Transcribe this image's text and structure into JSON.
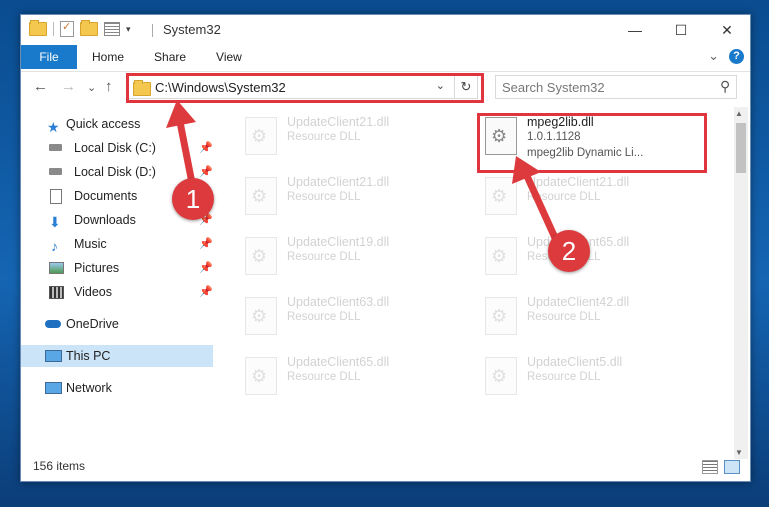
{
  "window": {
    "title": "System32",
    "minimize": "—",
    "maximize": "☐",
    "close": "✕"
  },
  "ribbon": {
    "tabs": [
      "File",
      "Home",
      "Share",
      "View"
    ],
    "expand": "⌄",
    "help": "?"
  },
  "nav": {
    "back": "←",
    "forward": "→",
    "recent": "⌄",
    "up": "↑",
    "address": "C:\\Windows\\System32",
    "address_drop": "⌄",
    "refresh": "↻",
    "search_placeholder": "Search System32",
    "search_icon": "⚲"
  },
  "sidebar": {
    "items": [
      {
        "label": "Quick access",
        "icon": "star-icon"
      },
      {
        "label": "Local Disk (C:)",
        "icon": "drive-icon",
        "pinned": true
      },
      {
        "label": "Local Disk (D:)",
        "icon": "drive-icon",
        "pinned": true
      },
      {
        "label": "Documents",
        "icon": "documents-icon",
        "pinned": true
      },
      {
        "label": "Downloads",
        "icon": "downloads-icon",
        "pinned": true
      },
      {
        "label": "Music",
        "icon": "music-icon",
        "pinned": true
      },
      {
        "label": "Pictures",
        "icon": "pictures-icon",
        "pinned": true
      },
      {
        "label": "Videos",
        "icon": "videos-icon",
        "pinned": true
      },
      {
        "label": "OneDrive",
        "icon": "cloud-icon"
      },
      {
        "label": "This PC",
        "icon": "computer-icon",
        "selected": true
      },
      {
        "label": "Network",
        "icon": "network-icon"
      }
    ],
    "pin": "📌"
  },
  "files": [
    {
      "name": "UpdateClient21.dll",
      "type": "Resource DLL"
    },
    {
      "name": "mpeg2lib.dll",
      "version": "1.0.1.1128",
      "desc": "mpeg2lib Dynamic Li..."
    },
    {
      "name": "UpdateClient21.dll",
      "type": "Resource DLL"
    },
    {
      "name": "UpdateClient21.dll",
      "type": "Resource DLL"
    },
    {
      "name": "UpdateClient19.dll",
      "type": "Resource DLL"
    },
    {
      "name": "UpdateClient65.dll",
      "type": "Resource DLL"
    },
    {
      "name": "UpdateClient63.dll",
      "type": "Resource DLL"
    },
    {
      "name": "UpdateClient42.dll",
      "type": "Resource DLL"
    },
    {
      "name": "UpdateClient65.dll",
      "type": "Resource DLL"
    },
    {
      "name": "UpdateClient5.dll",
      "type": "Resource DLL"
    }
  ],
  "status": {
    "items": "156 items"
  },
  "annotations": {
    "step1": "1",
    "step2": "2",
    "color": "#dd3a3e"
  }
}
